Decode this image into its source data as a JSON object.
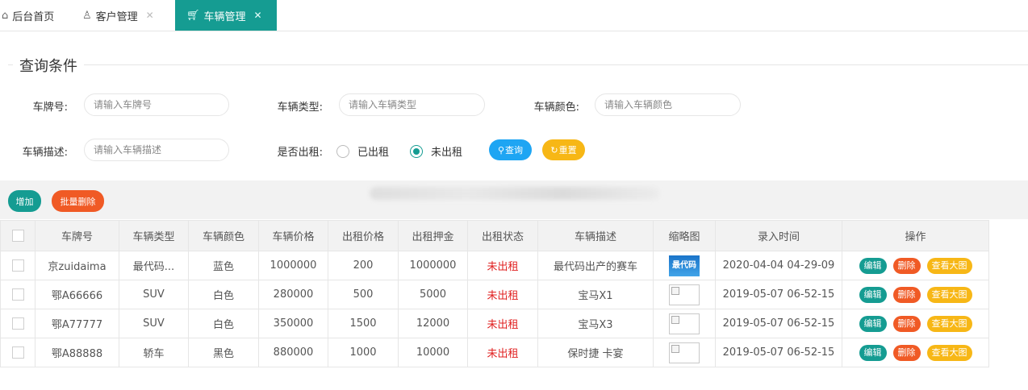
{
  "tabs": [
    {
      "label": "后台首页",
      "icon": "home-icon",
      "active": false
    },
    {
      "label": "客户管理",
      "icon": "user-icon",
      "active": false,
      "closable": true
    },
    {
      "label": "车辆管理",
      "icon": "cart-icon",
      "active": true,
      "closable": true
    }
  ],
  "close_glyph": "✕",
  "search": {
    "legend": "查询条件",
    "plate_label": "车牌号:",
    "plate_placeholder": "请输入车牌号",
    "type_label": "车辆类型:",
    "type_placeholder": "请输入车辆类型",
    "color_label": "车辆颜色:",
    "color_placeholder": "请输入车辆颜色",
    "desc_label": "车辆描述:",
    "desc_placeholder": "请输入车辆描述",
    "rented_label": "是否出租:",
    "rented_yes": "已出租",
    "rented_no": "未出租",
    "rented_selected": "未出租",
    "query_button": "查询",
    "reset_button": "重置"
  },
  "toolbar": {
    "add_button": "增加",
    "batch_delete_button": "批量删除"
  },
  "colors": {
    "primary": "#159c92",
    "danger": "#f05a25",
    "warning": "#f7b716",
    "info": "#1ea5f3",
    "status_red": "#e02020"
  },
  "table": {
    "headers": [
      "车牌号",
      "车辆类型",
      "车辆颜色",
      "车辆价格",
      "出租价格",
      "出租押金",
      "出租状态",
      "车辆描述",
      "缩略图",
      "录入时间",
      "操作"
    ],
    "rows": [
      {
        "plate": "京zuidaima",
        "type": "最代码...",
        "color": "蓝色",
        "price": "1000000",
        "rent": "200",
        "deposit": "1000000",
        "status": "未出租",
        "desc": "最代码出产的赛车",
        "thumb": "最代码",
        "time": "2020-04-04 04-29-09"
      },
      {
        "plate": "鄂A66666",
        "type": "SUV",
        "color": "白色",
        "price": "280000",
        "rent": "500",
        "deposit": "5000",
        "status": "未出租",
        "desc": "宝马X1",
        "thumb": "",
        "time": "2019-05-07 06-52-15"
      },
      {
        "plate": "鄂A77777",
        "type": "SUV",
        "color": "白色",
        "price": "350000",
        "rent": "1500",
        "deposit": "12000",
        "status": "未出租",
        "desc": "宝马X3",
        "thumb": "",
        "time": "2019-05-07 06-52-15"
      },
      {
        "plate": "鄂A88888",
        "type": "轿车",
        "color": "黑色",
        "price": "880000",
        "rent": "1000",
        "deposit": "10000",
        "status": "未出租",
        "desc": "保时捷 卡宴",
        "thumb": "",
        "time": "2019-05-07 06-52-15"
      }
    ],
    "actions": {
      "edit": "编辑",
      "delete": "删除",
      "view": "查看大图"
    }
  }
}
